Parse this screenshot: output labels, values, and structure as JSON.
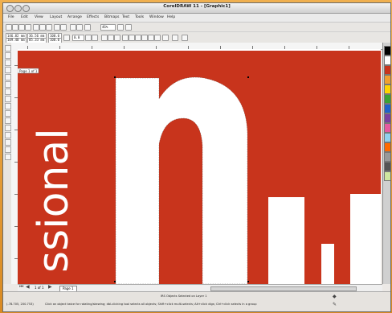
{
  "window": {
    "title": "CorelDRAW 11 - [Graphic1]"
  },
  "menu": [
    "File",
    "Edit",
    "View",
    "Layout",
    "Arrange",
    "Effects",
    "Bitmaps",
    "Text",
    "Tools",
    "Window",
    "Help"
  ],
  "property_bar": {
    "x_value": "146.82 mm",
    "y_value": "109.40 mm",
    "width_value": "36.56 mm",
    "height_value": "85.33 mm",
    "scale_x": "100.0",
    "scale_y": "100.0",
    "rotation": "0.0"
  },
  "zoom": "46%",
  "canvas": {
    "page_label": "Page 1 of 1",
    "artwork_text": "ssional",
    "big_letter": "n",
    "accent_color": "#c8341c",
    "art_fill": "#ffffff"
  },
  "page_tab": {
    "counter": "1 of 1",
    "label": "Page 1"
  },
  "status": {
    "selection": "IRS Objects Selected on Layer 1",
    "coords": "(-78.705, 200.753)",
    "hint": "Click an object twice for rotating/skewing; dbl-clicking tool selects all objects; Shift+click multi-selects; Alt+click digs; Ctrl+click selects in a group"
  },
  "palette_colors": [
    "#000000",
    "#ffffff",
    "#c8341c",
    "#f0a030",
    "#ffd400",
    "#3aa335",
    "#1f62c9",
    "#7a3fa0",
    "#e55aa0",
    "#8fd1ef",
    "#ff6a00",
    "#999999",
    "#555555",
    "#cfe6a0"
  ]
}
